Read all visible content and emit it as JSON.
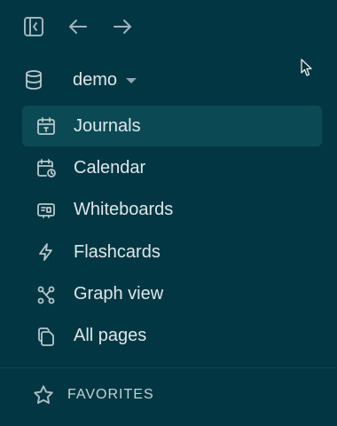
{
  "header": {
    "toggle_icon": "sidebar-toggle-icon",
    "back_icon": "arrow-left-icon",
    "forward_icon": "arrow-right-icon"
  },
  "graph": {
    "name": "demo",
    "icon": "database-icon"
  },
  "nav": {
    "items": [
      {
        "label": "Journals",
        "icon": "calendar-icon",
        "active": true
      },
      {
        "label": "Calendar",
        "icon": "calendar-clock-icon",
        "active": false
      },
      {
        "label": "Whiteboards",
        "icon": "whiteboard-icon",
        "active": false
      },
      {
        "label": "Flashcards",
        "icon": "bolt-icon",
        "active": false
      },
      {
        "label": "Graph view",
        "icon": "graph-icon",
        "active": false
      },
      {
        "label": "All pages",
        "icon": "pages-icon",
        "active": false
      }
    ]
  },
  "favorites": {
    "label": "FAVORITES",
    "icon": "star-icon"
  },
  "colors": {
    "background": "#023643",
    "active_item": "#0b4a55",
    "text": "#dfe7e9"
  }
}
